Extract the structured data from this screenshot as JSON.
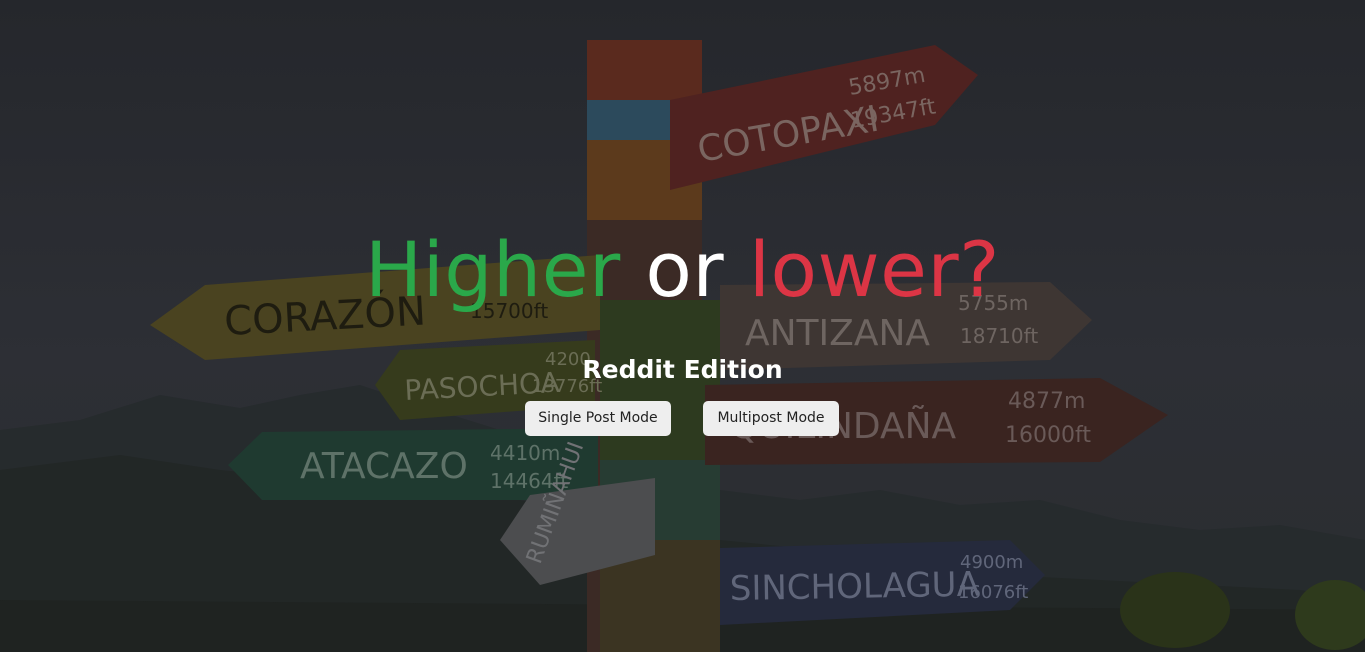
{
  "hero": {
    "title_higher": "Higher",
    "title_or": "or",
    "title_lower": "lower?",
    "subtitle": "Reddit Edition"
  },
  "buttons": {
    "single_post": "Single Post Mode",
    "multipost": "Multipost Mode"
  },
  "background_signs": {
    "cotopaxi": {
      "name": "COTOPAXI",
      "line1": "5897m",
      "line2": "19347ft"
    },
    "corazon": {
      "name": "CORAZÓN",
      "line1": "15700ft"
    },
    "antizana": {
      "name": "ANTIZANA",
      "line1": "5755m",
      "line2": "18710ft"
    },
    "pasochoa": {
      "name": "PASOCHOA",
      "line1": "4200",
      "line2": "13776ft"
    },
    "quilindana": {
      "name": "QUILINDAÑA",
      "line1": "4877m",
      "line2": "16000ft"
    },
    "atacazo": {
      "name": "ATACAZO",
      "line1": "4410m",
      "line2": "14464ft"
    },
    "rumi": {
      "name": "RUMIÑAHUI"
    },
    "sincholagua": {
      "name": "SINCHOLAGUA",
      "line1": "4900m",
      "line2": "16076ft"
    }
  },
  "colors": {
    "higher": "#2aa84a",
    "or": "#ffffff",
    "lower": "#dc3545",
    "button_bg": "#eeeeee"
  }
}
